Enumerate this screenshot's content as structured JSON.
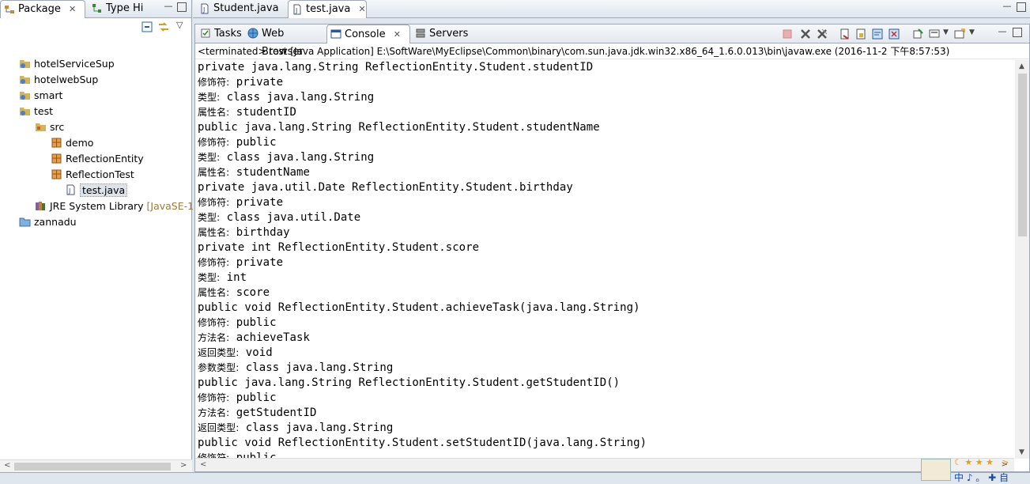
{
  "left_panel": {
    "tabs": [
      {
        "label": "Package",
        "icon": "package-explorer-icon"
      },
      {
        "label": "Type Hi",
        "icon": "type-hierarchy-icon"
      }
    ],
    "tree": [
      {
        "label": "hotelServiceSup",
        "icon": "project-icon",
        "level": 0
      },
      {
        "label": "hotelwebSup",
        "icon": "project-icon",
        "level": 0
      },
      {
        "label": "smart",
        "icon": "project-icon",
        "level": 0
      },
      {
        "label": "test",
        "icon": "project-icon",
        "level": 0
      },
      {
        "label": "src",
        "icon": "source-folder-icon",
        "level": 1
      },
      {
        "label": "demo",
        "icon": "package-icon",
        "level": 2
      },
      {
        "label": "ReflectionEntity",
        "icon": "package-icon",
        "level": 2
      },
      {
        "label": "ReflectionTest",
        "icon": "package-icon",
        "level": 2
      },
      {
        "label": "test.java",
        "icon": "java-file-icon",
        "level": 3,
        "selected": true
      },
      {
        "label": "JRE System Library",
        "suffix": "[JavaSE-1.6",
        "icon": "library-icon",
        "level": 1
      },
      {
        "label": "zannadu",
        "icon": "folder-icon",
        "level": 0
      }
    ]
  },
  "editor_tabs": [
    {
      "label": "Student.java"
    },
    {
      "label": "test.java"
    }
  ],
  "console_tabs": [
    {
      "label": "Tasks",
      "icon": "tasks-icon"
    },
    {
      "label": "Web Browser",
      "icon": "globe-icon"
    },
    {
      "label": "Console",
      "icon": "console-icon",
      "active": true
    },
    {
      "label": "Servers",
      "icon": "servers-icon"
    }
  ],
  "console": {
    "status": "<terminated> test [Java Application] E:\\SoftWare\\MyEclipse\\Common\\binary\\com.sun.java.jdk.win32.x86_64_1.6.0.013\\bin\\javaw.exe (2016-11-2 下午8:57:53)",
    "lines": [
      {
        "cn": "",
        "text": "private java.lang.String ReflectionEntity.Student.studentID"
      },
      {
        "cn": "修饰符:",
        "text": " private"
      },
      {
        "cn": "类型:",
        "text": " class java.lang.String"
      },
      {
        "cn": "属性名:",
        "text": " studentID"
      },
      {
        "cn": "",
        "text": "public java.lang.String ReflectionEntity.Student.studentName"
      },
      {
        "cn": "修饰符:",
        "text": " public"
      },
      {
        "cn": "类型:",
        "text": " class java.lang.String"
      },
      {
        "cn": "属性名:",
        "text": " studentName"
      },
      {
        "cn": "",
        "text": "private java.util.Date ReflectionEntity.Student.birthday"
      },
      {
        "cn": "修饰符:",
        "text": " private"
      },
      {
        "cn": "类型:",
        "text": " class java.util.Date"
      },
      {
        "cn": "属性名:",
        "text": " birthday"
      },
      {
        "cn": "",
        "text": "private int ReflectionEntity.Student.score"
      },
      {
        "cn": "修饰符:",
        "text": " private"
      },
      {
        "cn": "类型:",
        "text": " int"
      },
      {
        "cn": "属性名:",
        "text": " score"
      },
      {
        "cn": "",
        "text": "public void ReflectionEntity.Student.achieveTask(java.lang.String)"
      },
      {
        "cn": "修饰符:",
        "text": " public"
      },
      {
        "cn": "方法名:",
        "text": " achieveTask"
      },
      {
        "cn": "返回类型:",
        "text": " void"
      },
      {
        "cn": "参数类型:",
        "text": " class java.lang.String"
      },
      {
        "cn": "",
        "text": "public java.lang.String ReflectionEntity.Student.getStudentID()"
      },
      {
        "cn": "修饰符:",
        "text": " public"
      },
      {
        "cn": "方法名:",
        "text": " getStudentID"
      },
      {
        "cn": "返回类型:",
        "text": " class java.lang.String"
      },
      {
        "cn": "",
        "text": "public void ReflectionEntity.Student.setStudentID(java.lang.String)"
      },
      {
        "cn": "修饰符:",
        "text": " public"
      }
    ]
  },
  "ime": {
    "chars": "中 ♪ 。 ✚ 自"
  }
}
